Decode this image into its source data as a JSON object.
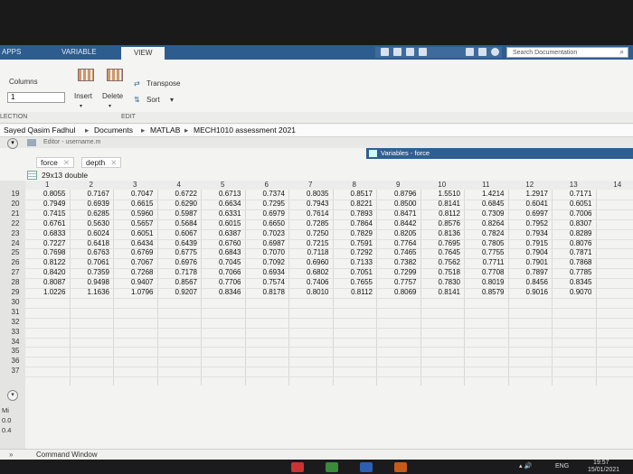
{
  "ribbon": {
    "tabs": [
      "APPS",
      "VARIABLE",
      "VIEW"
    ],
    "active_tab": "VARIABLE",
    "columns_label": "Columns",
    "columns_value": "1",
    "insert_label": "Insert",
    "delete_label": "Delete",
    "transpose_label": "Transpose",
    "sort_label": "Sort",
    "section_label": "LECTION",
    "edit_label": "EDIT",
    "search_placeholder": "Search Documentation"
  },
  "breadcrumb": [
    "Sayed Qasim Fadhul",
    "Documents",
    "MATLAB",
    "MECH1010 assessment 2021"
  ],
  "editor_title": "Editor - username.m",
  "variables_title": "Variables - force",
  "doc_tabs": [
    "force",
    "depth"
  ],
  "variable_size": "29x13 double",
  "table": {
    "column_numbers": [
      "1",
      "2",
      "3",
      "4",
      "5",
      "6",
      "7",
      "8",
      "9",
      "10",
      "11",
      "12",
      "13",
      "14"
    ],
    "row_numbers": [
      "19",
      "20",
      "21",
      "22",
      "23",
      "24",
      "25",
      "26",
      "27",
      "28",
      "29",
      "30",
      "31",
      "32",
      "33",
      "34",
      "35",
      "36",
      "37"
    ],
    "rows": [
      [
        "0.8055",
        "0.7167",
        "0.7047",
        "0.6722",
        "0.6713",
        "0.7374",
        "0.8035",
        "0.8517",
        "0.8796",
        "1.5510",
        "1.4214",
        "1.2917",
        "0.7171"
      ],
      [
        "0.7949",
        "0.6939",
        "0.6615",
        "0.6290",
        "0.6634",
        "0.7295",
        "0.7943",
        "0.8221",
        "0.8500",
        "0.8141",
        "0.6845",
        "0.6041",
        "0.6051"
      ],
      [
        "0.7415",
        "0.6285",
        "0.5960",
        "0.5987",
        "0.6331",
        "0.6979",
        "0.7614",
        "0.7893",
        "0.8471",
        "0.8112",
        "0.7309",
        "0.6997",
        "0.7006"
      ],
      [
        "0.6761",
        "0.5630",
        "0.5657",
        "0.5684",
        "0.6015",
        "0.6650",
        "0.7285",
        "0.7864",
        "0.8442",
        "0.8576",
        "0.8264",
        "0.7952",
        "0.8307"
      ],
      [
        "0.6833",
        "0.6024",
        "0.6051",
        "0.6067",
        "0.6387",
        "0.7023",
        "0.7250",
        "0.7829",
        "0.8205",
        "0.8136",
        "0.7824",
        "0.7934",
        "0.8289"
      ],
      [
        "0.7227",
        "0.6418",
        "0.6434",
        "0.6439",
        "0.6760",
        "0.6987",
        "0.7215",
        "0.7591",
        "0.7764",
        "0.7695",
        "0.7805",
        "0.7915",
        "0.8076"
      ],
      [
        "0.7698",
        "0.6763",
        "0.6769",
        "0.6775",
        "0.6843",
        "0.7070",
        "0.7118",
        "0.7292",
        "0.7465",
        "0.7645",
        "0.7755",
        "0.7904",
        "0.7871"
      ],
      [
        "0.8122",
        "0.7061",
        "0.7067",
        "0.6976",
        "0.7045",
        "0.7092",
        "0.6960",
        "0.7133",
        "0.7382",
        "0.7562",
        "0.7711",
        "0.7901",
        "0.7868"
      ],
      [
        "0.8420",
        "0.7359",
        "0.7268",
        "0.7178",
        "0.7066",
        "0.6934",
        "0.6802",
        "0.7051",
        "0.7299",
        "0.7518",
        "0.7708",
        "0.7897",
        "0.7785"
      ],
      [
        "0.8087",
        "0.9498",
        "0.9407",
        "0.8567",
        "0.7706",
        "0.7574",
        "0.7406",
        "0.7655",
        "0.7757",
        "0.7830",
        "0.8019",
        "0.8456",
        "0.8345"
      ],
      [
        "1.0226",
        "1.1636",
        "1.0796",
        "0.9207",
        "0.8346",
        "0.8178",
        "0.8010",
        "0.8112",
        "0.8069",
        "0.8141",
        "0.8579",
        "0.9016",
        "0.9070"
      ]
    ]
  },
  "left_panel_labels": [
    "Mi",
    "0.0",
    "0.4"
  ],
  "command_window_label": "Command Window",
  "taskbar": {
    "lang": "ENG",
    "time": "19:57",
    "date": "15/01/2021"
  }
}
